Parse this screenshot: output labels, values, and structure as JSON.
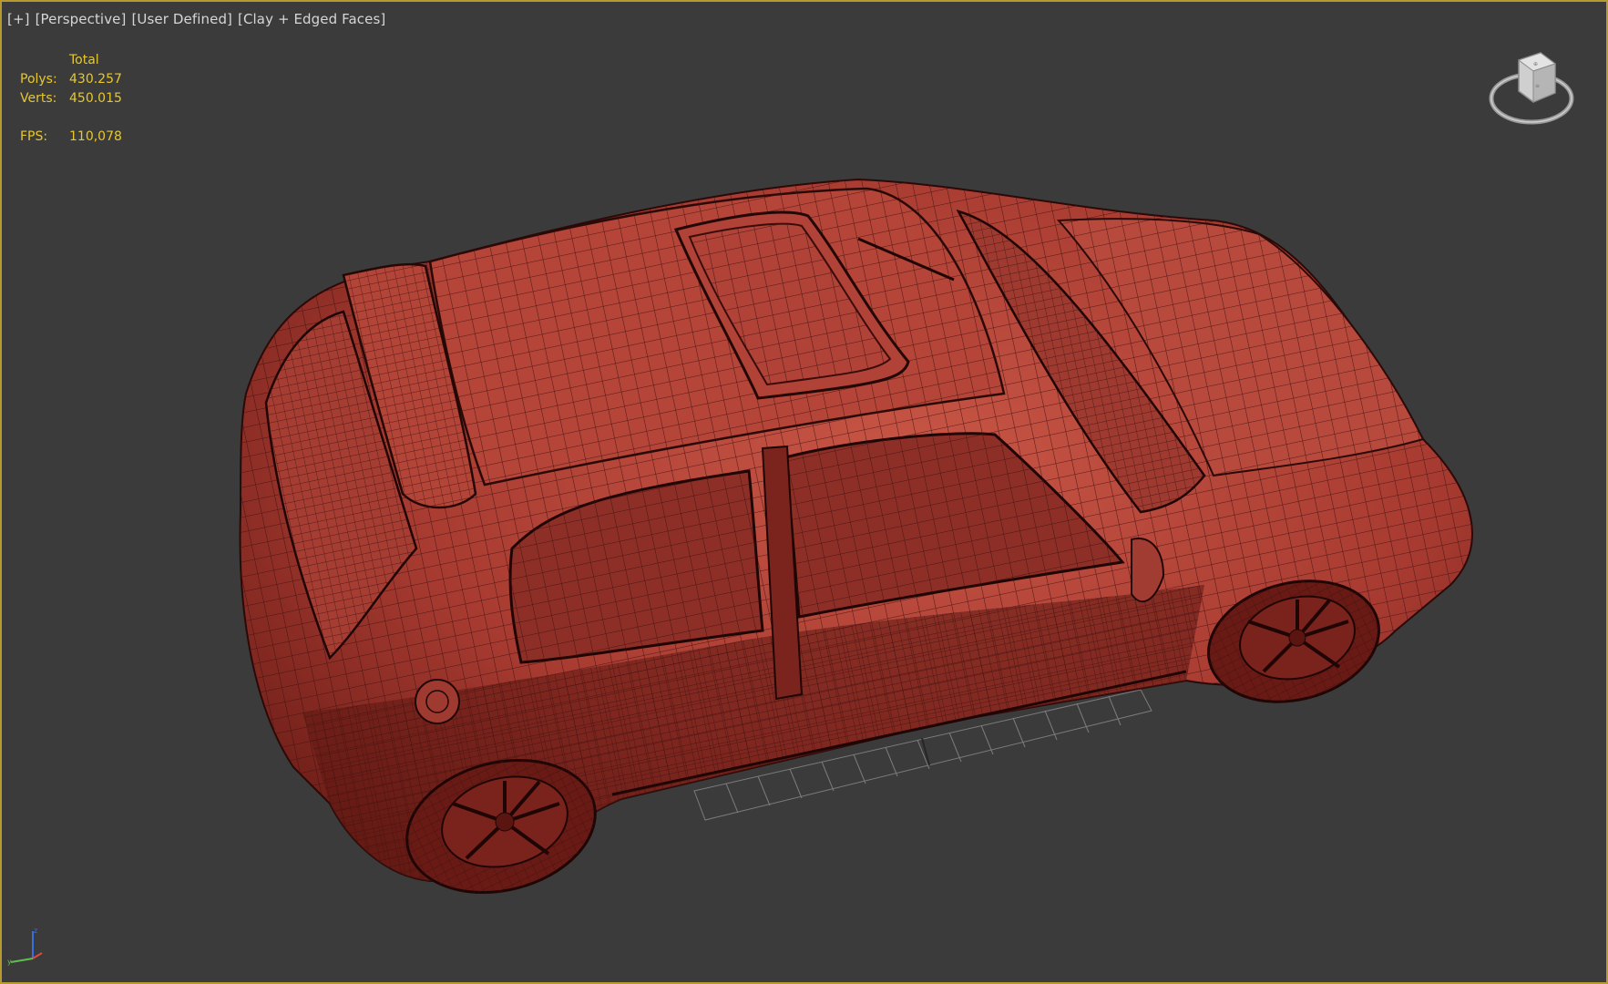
{
  "viewport": {
    "label_parts": [
      "[+]",
      "[Perspective]",
      "[User Defined]",
      "[Clay + Edged Faces]"
    ]
  },
  "stats": {
    "header": "Total",
    "polys_label": "Polys:",
    "polys_value": "430.257",
    "verts_label": "Verts:",
    "verts_value": "450.015",
    "fps_label": "FPS:",
    "fps_value": "110,078"
  },
  "colors": {
    "viewport_bg": "#3b3b3b",
    "viewport_border": "#b79a2e",
    "stats_text": "#e6c82e",
    "clay": "#b8453a",
    "wire": "#3d1210"
  },
  "icons": {
    "viewcube": "viewcube-icon",
    "axis_tripod": "axis-tripod-icon"
  }
}
